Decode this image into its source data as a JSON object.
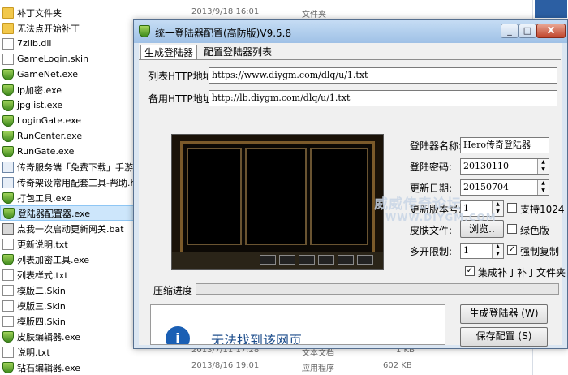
{
  "explorer": {
    "files": [
      {
        "name": "补丁文件夹",
        "icon": "folder-icon",
        "selected": false
      },
      {
        "name": "无法点开始补丁",
        "icon": "folder-icon",
        "selected": false
      },
      {
        "name": "7zlib.dll",
        "icon": "document-icon",
        "selected": false
      },
      {
        "name": "GameLogin.skin",
        "icon": "document-icon",
        "selected": false
      },
      {
        "name": "GameNet.exe",
        "icon": "shield-icon",
        "selected": false
      },
      {
        "name": "ip加密.exe",
        "icon": "shield-icon",
        "selected": false
      },
      {
        "name": "jpglist.exe",
        "icon": "shield-icon",
        "selected": false
      },
      {
        "name": "LoginGate.exe",
        "icon": "shield-icon",
        "selected": false
      },
      {
        "name": "RunCenter.exe",
        "icon": "shield-icon",
        "selected": false
      },
      {
        "name": "RunGate.exe",
        "icon": "shield-icon",
        "selected": false
      },
      {
        "name": "传奇服务端「免费下载」手游游",
        "icon": "application-icon",
        "selected": false
      },
      {
        "name": "传奇架设常用配套工具-帮助.ht",
        "icon": "application-icon",
        "selected": false
      },
      {
        "name": "打包工具.exe",
        "icon": "shield-icon",
        "selected": false
      },
      {
        "name": "登陆器配置器.exe",
        "icon": "shield-icon",
        "selected": true
      },
      {
        "name": "点我一次启动更新网关.bat",
        "icon": "batch-file-icon",
        "selected": false
      },
      {
        "name": "更新说明.txt",
        "icon": "document-icon",
        "selected": false
      },
      {
        "name": "列表加密工具.exe",
        "icon": "shield-icon",
        "selected": false
      },
      {
        "name": "列表样式.txt",
        "icon": "document-icon",
        "selected": false
      },
      {
        "name": "模版二.Skin",
        "icon": "document-icon",
        "selected": false
      },
      {
        "name": "模版三.Skin",
        "icon": "document-icon",
        "selected": false
      },
      {
        "name": "模版四.Skin",
        "icon": "document-icon",
        "selected": false
      },
      {
        "name": "皮肤编辑器.exe",
        "icon": "shield-icon",
        "selected": false
      },
      {
        "name": "说明.txt",
        "icon": "document-icon",
        "selected": false
      },
      {
        "name": "钻石编辑器.exe",
        "icon": "shield-icon",
        "selected": false
      }
    ],
    "row0_date": "2013/9/18 16:01",
    "row0_type": "文件夹",
    "row22_date": "2013/7/11 17:28",
    "row22_type": "文本文档",
    "row22_size": "1 KB",
    "row23_date": "2013/8/16 19:01",
    "row23_type": "应用程序",
    "row23_size": "602 KB"
  },
  "dialog": {
    "title": "统一登陆器配置(高防版)V9.5.8",
    "minimize": "_",
    "maximize": "□",
    "close": "X",
    "tabs": [
      "生成登陆器",
      "配置登陆器列表"
    ],
    "list_url_label": "列表HTTP地址",
    "list_url_value": "https://www.diygm.com/dlq/u/1.txt",
    "backup_url_label": "备用HTTP地址",
    "backup_url_value": "http://lb.diygm.com/dlq/u/1.txt",
    "name_label": "登陆器名称:",
    "name_value": "Hero传奇登陆器",
    "password_label": "登陆密码:",
    "password_value": "20130110",
    "update_date_label": "更新日期:",
    "update_date_value": "20150704",
    "version_label": "更新版本号:",
    "version_value": "1",
    "support1024_label": "支持1024",
    "support1024_checked": false,
    "skin_label": "皮肤文件:",
    "browse_button": "浏览..",
    "green_label": "绿色版",
    "green_checked": false,
    "multi_label": "多开限制:",
    "multi_value": "1",
    "force_copy_label": "强制复制",
    "force_copy_checked": true,
    "patch_folder_label": "集成补丁补丁文件夹",
    "patch_folder_checked": true,
    "progress_label": "压缩进度",
    "progress_value": 0,
    "generate_button": "生成登陆器 (W)",
    "save_button": "保存配置 (S)",
    "browser_error": "无法找到该网页",
    "watermark_line1": "威威传奇论坛",
    "watermark_line2": "WWW.DIYGM.COM"
  }
}
